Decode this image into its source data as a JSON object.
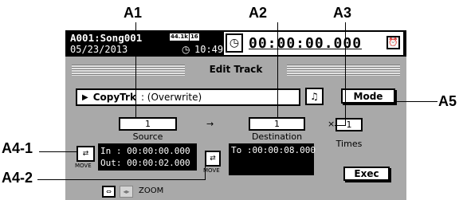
{
  "callouts": {
    "a1": "A1",
    "a2": "A2",
    "a3": "A3",
    "a4_1": "A4-1",
    "a4_2": "A4-2",
    "a5": "A5"
  },
  "header": {
    "song": "A001:Song001",
    "date": "05/23/2013",
    "sample_rate": "44.1k",
    "bit_depth": "16",
    "clock_time": "10:49",
    "counter": "00:00:00.000"
  },
  "title": "Edit Track",
  "command": {
    "name": "CopyTrk",
    "option": ": (Overwrite)"
  },
  "mode_label": "Mode",
  "source": {
    "value": "1",
    "label": "Source"
  },
  "destination": {
    "value": "1",
    "label": "Destination"
  },
  "times": {
    "value": "1",
    "label": "Times",
    "symbol": "×"
  },
  "arrow_symbol": "→",
  "range": {
    "in": "In : 00:00:00.000",
    "out": "Out: 00:00:02.000"
  },
  "to": "To :00:00:08.000",
  "exec_label": "Exec",
  "move_label": "MOVE",
  "zoom_label": "ZOOM"
}
